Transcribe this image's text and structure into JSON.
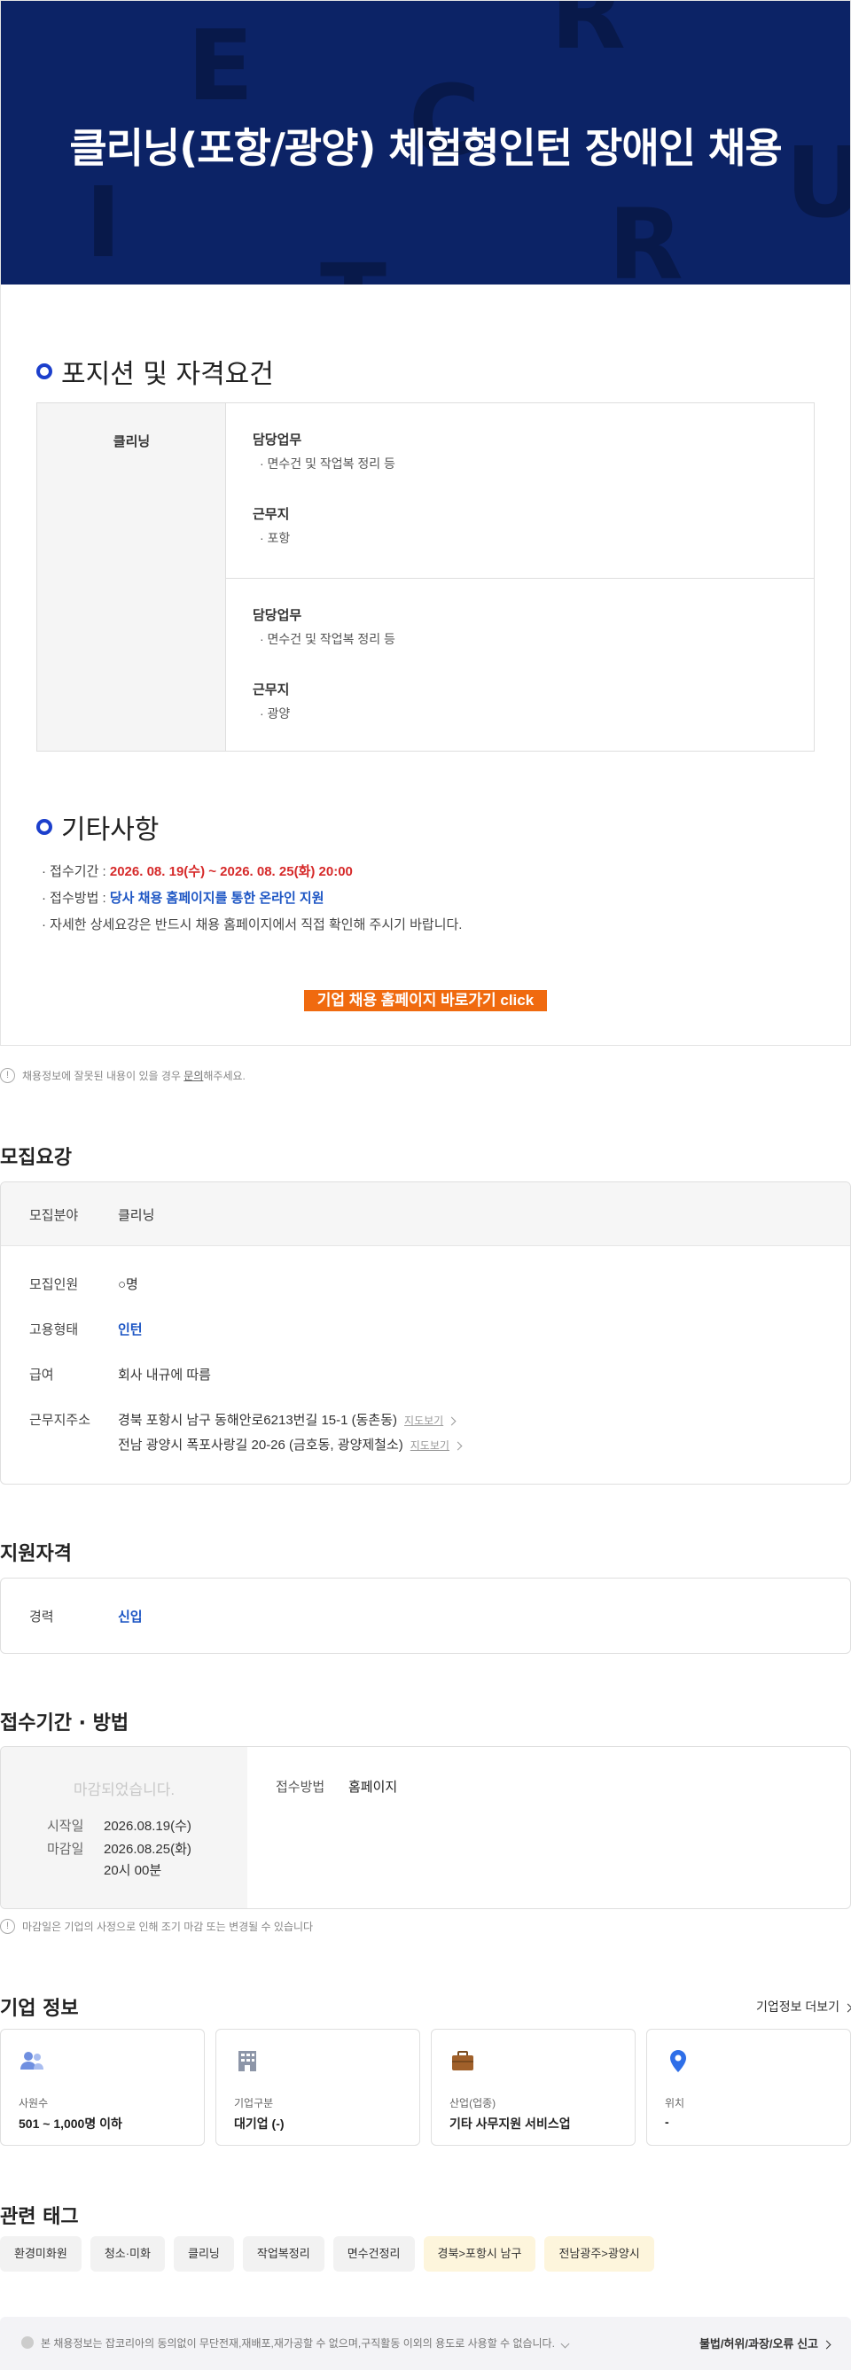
{
  "banner": {
    "title": "클리닝(포항/광양) 체험형인턴 장애인 채용",
    "bg_letters": [
      "E",
      "R",
      "C",
      "I",
      "R",
      "U",
      "T"
    ]
  },
  "position": {
    "section_title": "포지션 및 자격요건",
    "field": "클리닝",
    "rows": [
      {
        "duty_label": "담당업무",
        "duty": "· 면수건 및 작업복 정리 등",
        "loc_label": "근무지",
        "loc": "· 포항"
      },
      {
        "duty_label": "담당업무",
        "duty": "· 면수건 및 작업복 정리 등",
        "loc_label": "근무지",
        "loc": "· 광양"
      }
    ]
  },
  "misc": {
    "section_title": "기타사항",
    "period_label": "· 접수기간 : ",
    "period_value": "2026. 08. 19(수) ~ 2026. 08. 25(화) 20:00",
    "method_label": "· 접수방법 : ",
    "method_value": "당사 채용 홈페이지를 통한 온라인 지원",
    "detail": "· 자세한 상세요강은 반드시 채용 홈페이지에서 직접 확인해 주시기 바랍니다.",
    "cta": "기업 채용 홈페이지 바로가기 click"
  },
  "notice1": {
    "pre": "채용정보에 잘못된 내용이 있을 경우 ",
    "link": "문의",
    "post": "해주세요."
  },
  "recruit": {
    "title": "모집요강",
    "field_label": "모집분야",
    "field_value": "클리닝",
    "count_label": "모집인원",
    "count_value": "○명",
    "type_label": "고용형태",
    "type_value": "인턴",
    "pay_label": "급여",
    "pay_value": "회사 내규에 따름",
    "addr_label": "근무지주소",
    "addr1": "경북 포항시 남구 동해안로6213번길 15-1 (동촌동)",
    "addr2": "전남 광양시 폭포사랑길 20-26 (금호동, 광양제철소)",
    "map_link": "지도보기"
  },
  "qual": {
    "title": "지원자격",
    "career_label": "경력",
    "career_value": "신입"
  },
  "apply": {
    "title": "접수기간 · 방법",
    "status": "마감되었습니다.",
    "start_label": "시작일",
    "start_value": "2026.08.19(수)",
    "end_label": "마감일",
    "end_value": "2026.08.25(화)",
    "end_time": "20시 00분",
    "method_label": "접수방법",
    "method_value": "홈페이지",
    "notice": "마감일은 기업의 사정으로 인해 조기 마감 또는 변경될 수 있습니다"
  },
  "company": {
    "title": "기업 정보",
    "more": "기업정보 더보기",
    "cards": [
      {
        "label": "사원수",
        "value": "501 ~ 1,000명 이하",
        "icon": "people-icon"
      },
      {
        "label": "기업구분",
        "value": "대기업 (-)",
        "icon": "building-icon"
      },
      {
        "label": "산업(업종)",
        "value": "기타 사무지원 서비스업",
        "icon": "briefcase-icon"
      },
      {
        "label": "위치",
        "value": "-",
        "icon": "location-pin-icon"
      }
    ]
  },
  "tags": {
    "title": "관련 태그",
    "items": [
      "환경미화원",
      "청소·미화",
      "클리닝",
      "작업복정리",
      "면수건정리",
      "경북>포항시 남구",
      "전남광주>광양시"
    ]
  },
  "footer": {
    "text": "본 채용정보는 잡코리아의 동의없이 무단전재,재배포,재가공할 수 없으며,구직활동 이외의 용도로 사용할 수 없습니다.",
    "report": "불법/허위/과장/오류 신고"
  },
  "colors": {
    "banner": "#0c2366",
    "accent_blue": "#1c55c4",
    "cta_orange": "#f06a0f",
    "red": "#d62a2a"
  }
}
